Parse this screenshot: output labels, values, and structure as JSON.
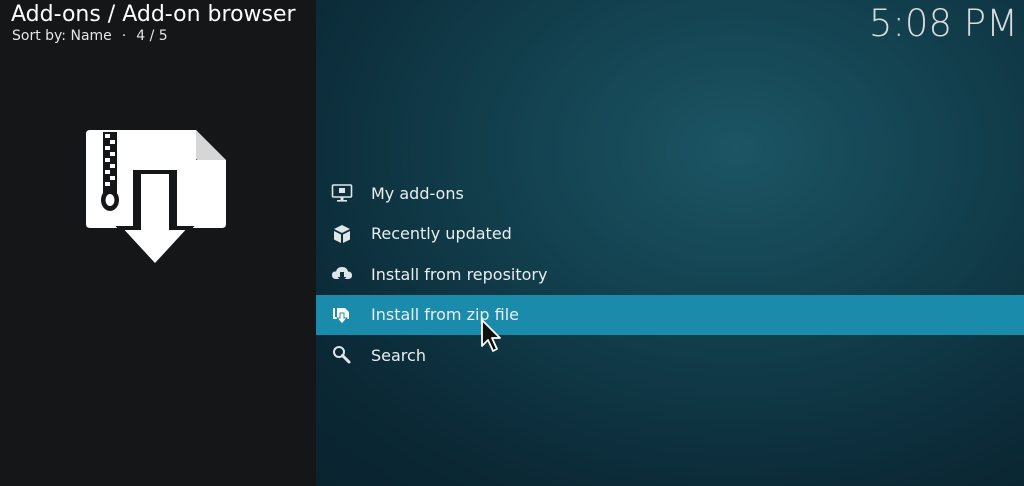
{
  "header": {
    "title": "Add-ons / Add-on browser",
    "sort_label": "Sort by: Name",
    "separator": "·",
    "position": "4 / 5"
  },
  "clock": "5:08 PM",
  "hero_icon": "zip-download-icon",
  "menu": {
    "items": [
      {
        "label": "My add-ons",
        "icon": "monitor-box-icon"
      },
      {
        "label": "Recently updated",
        "icon": "box-icon"
      },
      {
        "label": "Install from repository",
        "icon": "cloud-download-icon"
      },
      {
        "label": "Install from zip file",
        "icon": "zip-install-icon"
      },
      {
        "label": "Search",
        "icon": "search-icon"
      }
    ],
    "selected_index": 3
  },
  "colors": {
    "left_panel": "#151617",
    "selection": "#1b8bab",
    "text": "#e9eef0"
  }
}
